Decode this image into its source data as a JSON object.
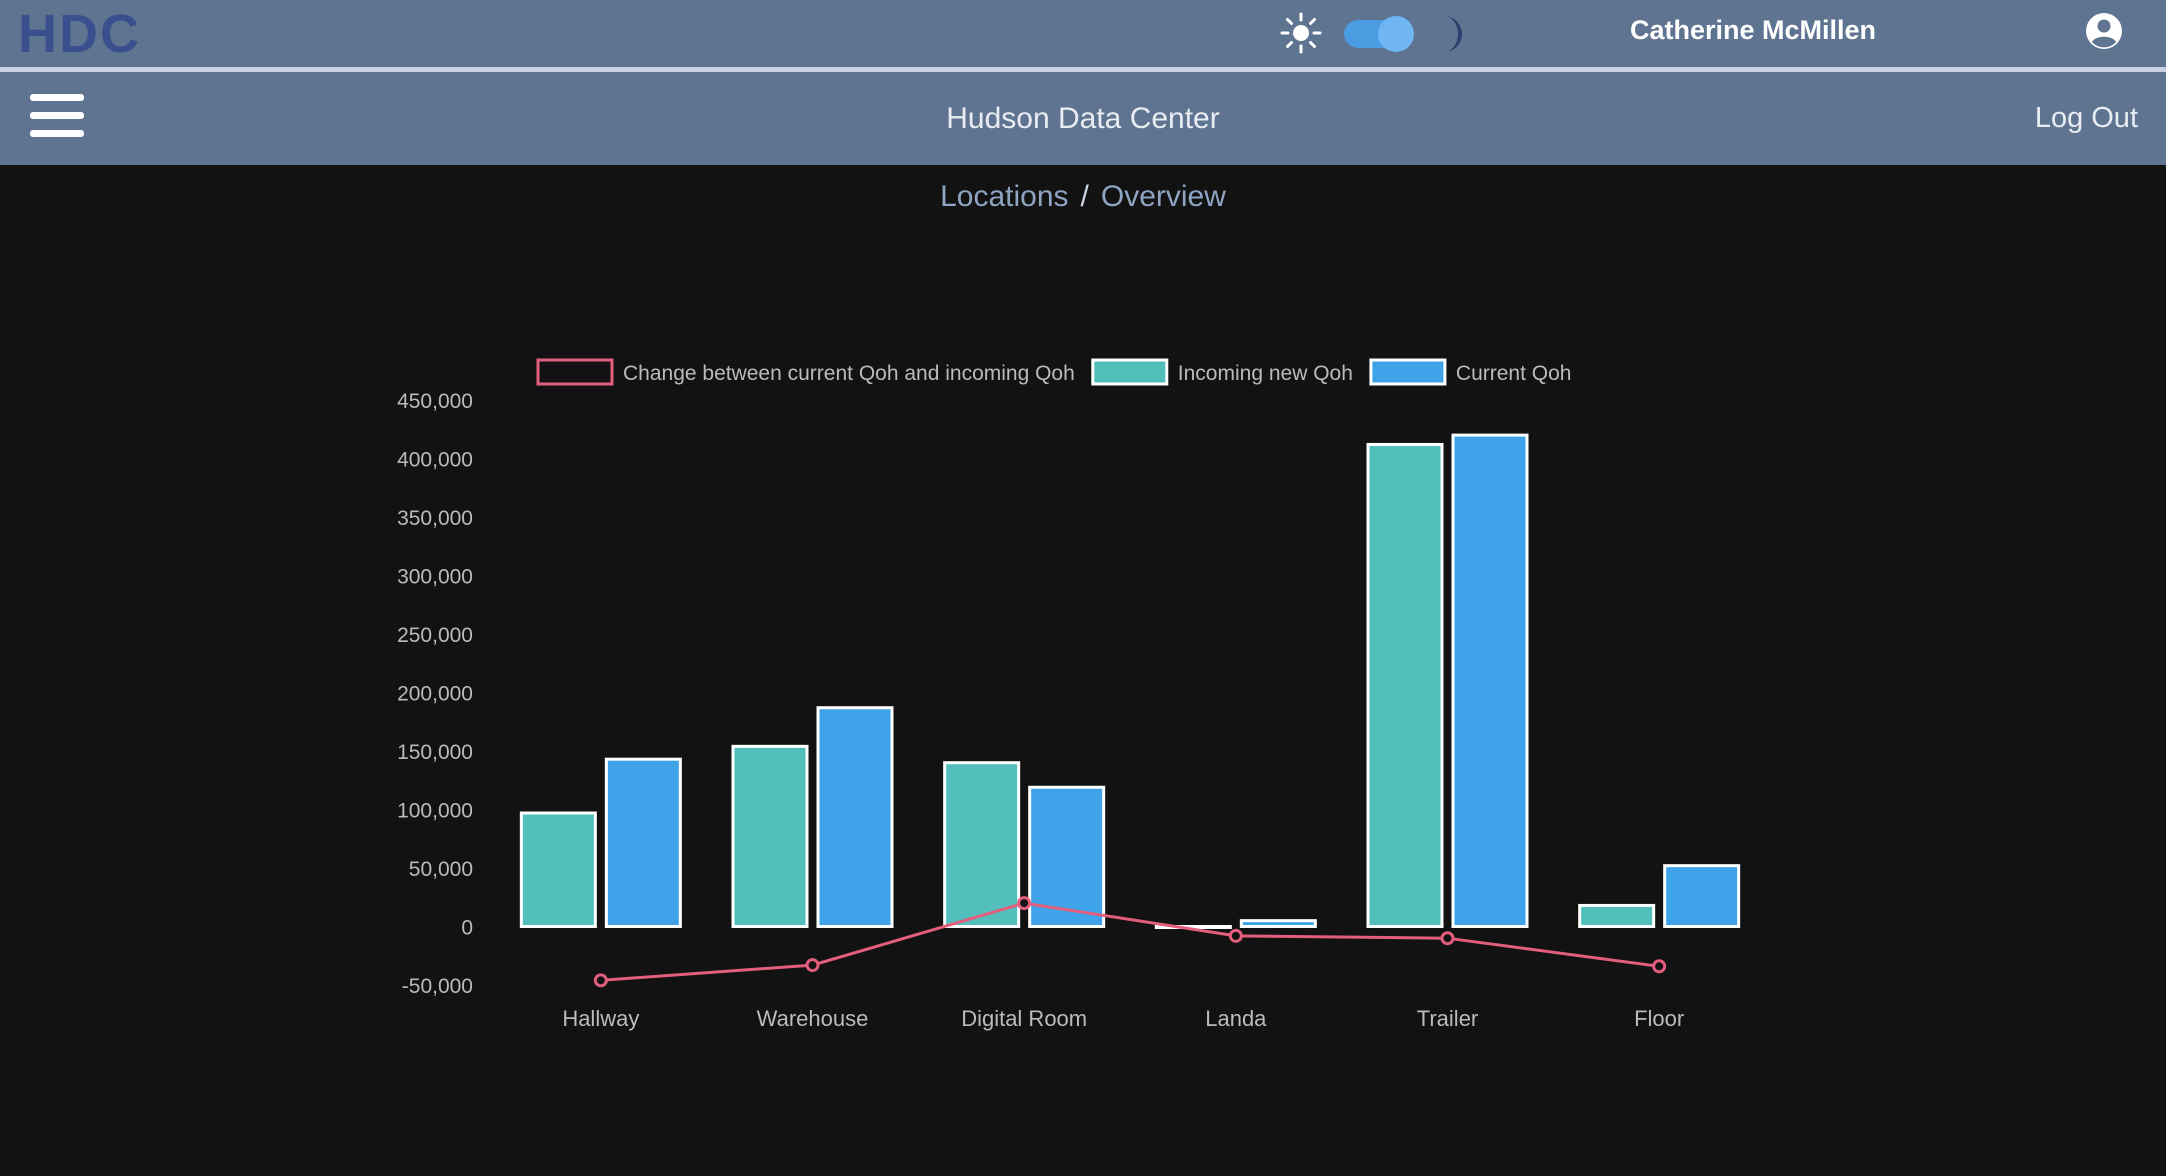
{
  "header": {
    "logo_text": "HDC",
    "user_name": "Catherine McMillen",
    "theme_toggle_state": "dark"
  },
  "nav": {
    "title": "Hudson Data Center",
    "logout_label": "Log Out"
  },
  "breadcrumb": {
    "items": [
      "Locations",
      "Overview"
    ],
    "separator": "/"
  },
  "colors": {
    "bar_incoming": "#52bfbd",
    "bar_current": "#3ea3e8",
    "line_change": "#e35d7d",
    "header_bg": "#5f7491",
    "page_bg": "#121212"
  },
  "chart_data": {
    "type": "bar",
    "categories": [
      "Hallway",
      "Warehouse",
      "Digital Room",
      "Landa",
      "Trailer",
      "Floor"
    ],
    "series": [
      {
        "name": "Change between current Qoh and incoming Qoh",
        "type": "line",
        "color": "#e35d7d",
        "values": [
          -46000,
          -33000,
          20000,
          -8000,
          -10000,
          -34000
        ]
      },
      {
        "name": "Incoming new Qoh",
        "type": "bar",
        "color": "#52bfbd",
        "values": [
          97000,
          154000,
          140000,
          0,
          412000,
          18000
        ]
      },
      {
        "name": "Current Qoh",
        "type": "bar",
        "color": "#3ea3e8",
        "values": [
          143000,
          187000,
          119000,
          5000,
          420000,
          52000
        ]
      }
    ],
    "ylim": [
      -50000,
      450000
    ],
    "yticks": [
      -50000,
      0,
      50000,
      100000,
      150000,
      200000,
      250000,
      300000,
      350000,
      400000,
      450000
    ],
    "ytick_labels": [
      "-50,000",
      "0",
      "50,000",
      "100,000",
      "150,000",
      "200,000",
      "250,000",
      "300,000",
      "350,000",
      "400,000",
      "450,000"
    ],
    "legend_position": "top",
    "grid": false
  }
}
